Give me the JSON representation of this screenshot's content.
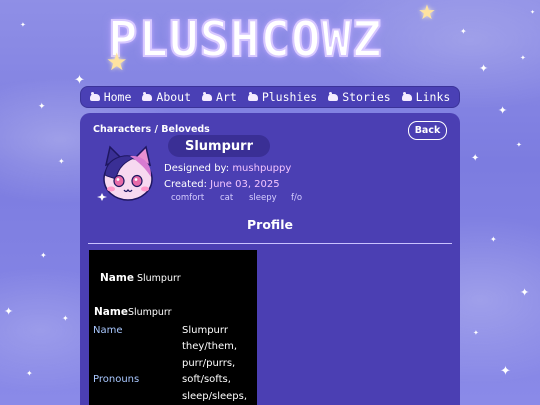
{
  "logo": {
    "text": "PLUSHCOWZ"
  },
  "nav": [
    {
      "label": "Home"
    },
    {
      "label": "About"
    },
    {
      "label": "Art"
    },
    {
      "label": "Plushies"
    },
    {
      "label": "Stories"
    },
    {
      "label": "Links"
    }
  ],
  "breadcrumb": "Characters / Beloveds",
  "back_label": "Back",
  "character": {
    "name": "Slumpurr",
    "designed_by_label": "Designed by:",
    "designer": "mushpuppy",
    "created_label": "Created:",
    "created_date": "June 03, 2025",
    "tags": [
      "comfort",
      "cat",
      "sleepy",
      "f/o"
    ]
  },
  "profile": {
    "title": "Profile",
    "name_label_1": "Name",
    "name_value_1": "Slumpurr",
    "name_label_2": "Name",
    "name_value_2": "Slumpurr",
    "rows": [
      {
        "label": "Name",
        "value": "Slumpurr"
      },
      {
        "label": "Pronouns",
        "value_lines": [
          "they/them,",
          "purr/purrs,",
          "soft/softs,",
          "sleep/sleeps,"
        ]
      }
    ]
  },
  "colors": {
    "background": "#8585e3",
    "panel": "#4b3fb3",
    "nav": "#4a40b5",
    "name_pill": "#3a2f95",
    "profile_box": "#000000",
    "label_blue": "#a9c8ff",
    "accent_pink": "#f2c4ff"
  },
  "icons": [
    "star-icon",
    "cow-icon",
    "avatar-cat"
  ]
}
